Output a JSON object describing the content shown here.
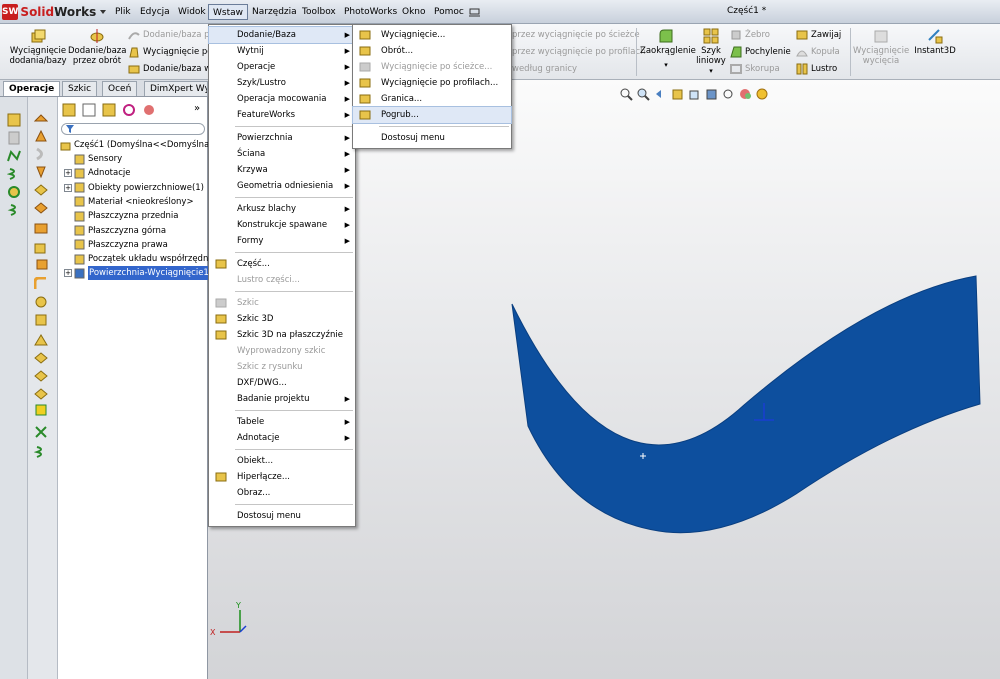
{
  "app": {
    "logo_prefix": "Solid",
    "logo_suffix": "Works",
    "logo_mark": "SW",
    "document_title": "Część1 *"
  },
  "menubar": {
    "items": [
      "Plik",
      "Edycja",
      "Widok",
      "Wstaw",
      "Narzędzia",
      "Toolbox",
      "PhotoWorks",
      "Okno",
      "Pomoc"
    ],
    "active": "Wstaw"
  },
  "ribbon": {
    "extrude_base": "Wyciągnięcie\ndodania/bazy",
    "revolve_base": "Dodanie/baza\nprzez obrót",
    "sweep_base": "Dodanie/baza pr",
    "sweep_path": "Wyciągnięcie po",
    "loft_base": "Dodanie/baza w",
    "cut_sweep": "przez wyciągnięcie po ścieżce",
    "cut_loft": "przez wyciągnięcie po profilach",
    "cut_boundary": "według granicy",
    "fillet": "Zaokrąglenie",
    "linear_pattern": "Szyk\nliniowy",
    "rib": "Żebro",
    "draft": "Pochylenie",
    "shell": "Skorupa",
    "wrap": "Zawijaj",
    "dome": "Kopuła",
    "mirror": "Lustro",
    "cut_extrude": "Wyciągnięcie\nwycięcia",
    "instant3d": "Instant3D"
  },
  "tabs": [
    "Operacje",
    "Szkic",
    "Oceń",
    "DimXpert Wy"
  ],
  "active_tab": "Operacje",
  "tree": {
    "root": "Część1  (Domyślna<<Domyślna>_",
    "items": [
      {
        "label": "Sensory",
        "expandable": false
      },
      {
        "label": "Adnotacje",
        "expandable": true
      },
      {
        "label": "Obiekty powierzchniowe(1)",
        "expandable": true
      },
      {
        "label": "Materiał <nieokreślony>",
        "expandable": false
      },
      {
        "label": "Płaszczyzna przednia",
        "expandable": false
      },
      {
        "label": "Płaszczyzna górna",
        "expandable": false
      },
      {
        "label": "Płaszczyzna prawa",
        "expandable": false
      },
      {
        "label": "Początek układu współrzędnych",
        "expandable": false
      },
      {
        "label": "Powierzchnia-Wyciągnięcie1",
        "expandable": true,
        "selected": true
      }
    ]
  },
  "insert_menu": {
    "items": [
      {
        "label": "Dodanie/Baza",
        "submenu": true,
        "highlighted": true
      },
      {
        "label": "Wytnij",
        "submenu": true
      },
      {
        "label": "Operacje",
        "submenu": true
      },
      {
        "label": "Szyk/Lustro",
        "submenu": true
      },
      {
        "label": "Operacja mocowania",
        "submenu": true
      },
      {
        "label": "FeatureWorks",
        "submenu": true
      },
      {
        "sep": true
      },
      {
        "label": "Powierzchnia",
        "submenu": true
      },
      {
        "label": "Ściana",
        "submenu": true
      },
      {
        "label": "Krzywa",
        "submenu": true
      },
      {
        "label": "Geometria odniesienia",
        "submenu": true
      },
      {
        "sep": true
      },
      {
        "label": "Arkusz blachy",
        "submenu": true
      },
      {
        "label": "Konstrukcje spawane",
        "submenu": true
      },
      {
        "label": "Formy",
        "submenu": true
      },
      {
        "sep": true
      },
      {
        "label": "Część...",
        "icon": "part-icon"
      },
      {
        "label": "Lustro części...",
        "disabled": true
      },
      {
        "sep": true
      },
      {
        "label": "Szkic",
        "disabled": true,
        "icon": "sketch-icon"
      },
      {
        "label": "Szkic 3D",
        "icon": "sketch3d-icon"
      },
      {
        "label": "Szkic 3D na płaszczyźnie",
        "icon": "sketch3d-plane-icon"
      },
      {
        "label": "Wyprowadzony szkic",
        "disabled": true
      },
      {
        "label": "Szkic z rysunku",
        "disabled": true
      },
      {
        "label": "DXF/DWG..."
      },
      {
        "label": "Badanie projektu",
        "submenu": true
      },
      {
        "sep": true
      },
      {
        "label": "Tabele",
        "submenu": true
      },
      {
        "label": "Adnotacje",
        "submenu": true
      },
      {
        "sep": true
      },
      {
        "label": "Obiekt..."
      },
      {
        "label": "Hiperłącze...",
        "icon": "globe-icon"
      },
      {
        "label": "Obraz..."
      },
      {
        "sep": true
      },
      {
        "label": "Dostosuj menu"
      }
    ]
  },
  "sub_menu": {
    "items": [
      {
        "label": "Wyciągnięcie...",
        "icon": "extrude-icon"
      },
      {
        "label": "Obrót...",
        "icon": "revolve-icon"
      },
      {
        "label": "Wyciągnięcie po ścieżce...",
        "icon": "sweep-icon",
        "disabled": true
      },
      {
        "label": "Wyciągnięcie po profilach...",
        "icon": "loft-icon"
      },
      {
        "label": "Granica...",
        "icon": "boundary-icon"
      },
      {
        "label": "Pogrub...",
        "icon": "thicken-icon",
        "highlighted": true
      },
      {
        "sep": true
      },
      {
        "label": "Dostosuj menu"
      }
    ]
  },
  "colors": {
    "surface": "#0d4f9e",
    "highlight": "#3366cc",
    "menu_hl": "#dfe8f6"
  }
}
